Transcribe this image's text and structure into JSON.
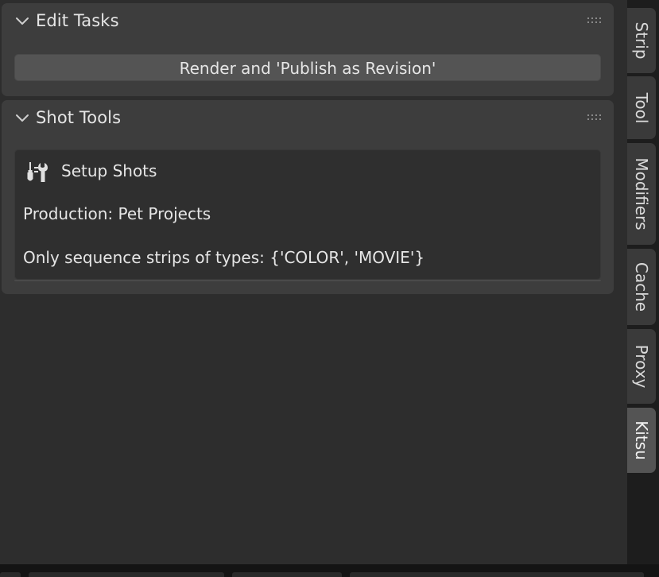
{
  "panels": {
    "edit_tasks": {
      "title": "Edit Tasks",
      "render_button_label": "Render and 'Publish as Revision'"
    },
    "shot_tools": {
      "title": "Shot Tools",
      "setup_title": "Setup Shots",
      "production_line": "Production: Pet Projects",
      "strip_types_line": "Only sequence strips of types: {'COLOR', 'MOVIE'}"
    }
  },
  "tabs": [
    {
      "label": "Strip",
      "active": false
    },
    {
      "label": "Tool",
      "active": false
    },
    {
      "label": "Modifiers",
      "active": false
    },
    {
      "label": "Cache",
      "active": false
    },
    {
      "label": "Proxy",
      "active": false
    },
    {
      "label": "Kitsu",
      "active": true
    }
  ],
  "icons": {
    "panel_collapse": "chevron-down-icon",
    "panel_drag": "drag-grip-icon",
    "setup_shots": "tools-icon"
  },
  "colors": {
    "background": "#2d2d2d",
    "panel": "#3d3d3d",
    "button": "#545454",
    "text": "#e6e6e6",
    "tab_active": "#545454",
    "tab_inactive": "#3a3a3a"
  }
}
